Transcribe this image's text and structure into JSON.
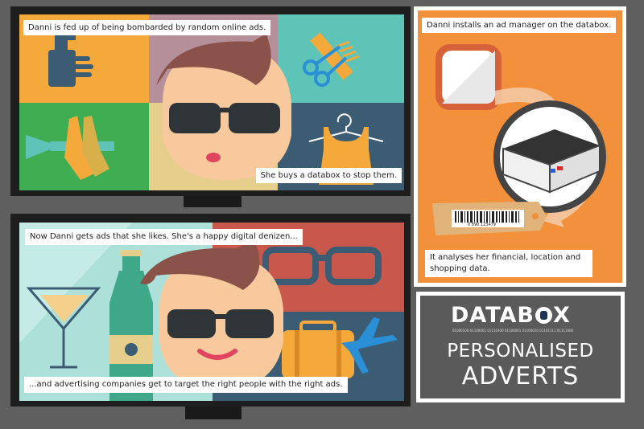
{
  "panel1": {
    "caption_top": "Danni is fed up of being bombarded by random online ads.",
    "caption_bottom": "She buys a databox to stop them.",
    "colors": {
      "orange": "#f4a93a",
      "mauve": "#b58f9a",
      "teal": "#5ec4b8",
      "green": "#3fae52",
      "sand": "#e6cf8c",
      "slate": "#3c5c73"
    }
  },
  "panel2": {
    "caption_top": "Now Danni gets ads that she likes.  She's a happy digital denizen...",
    "caption_bottom": "...and advertising companies get to target the right people with the right ads.",
    "colors": {
      "aqua": "#aee0da",
      "red": "#c9584c",
      "navy": "#3c5c73"
    }
  },
  "panel3": {
    "caption_top": "Danni installs an ad manager on the databox.",
    "caption_bottom": "It analyses her financial, location and shopping data.",
    "barcode_number": "0 890 123479",
    "colors": {
      "orange": "#f2903c",
      "tag": "#e0b37a"
    }
  },
  "brand": {
    "logo_text_left": "DATAB",
    "logo_text_right": "X",
    "binary_strip": "01000100 01100001 01110100 01100001 01100010 01101111 01111000",
    "title_line1": "PERSONALISED",
    "title_line2": "ADVERTS"
  }
}
